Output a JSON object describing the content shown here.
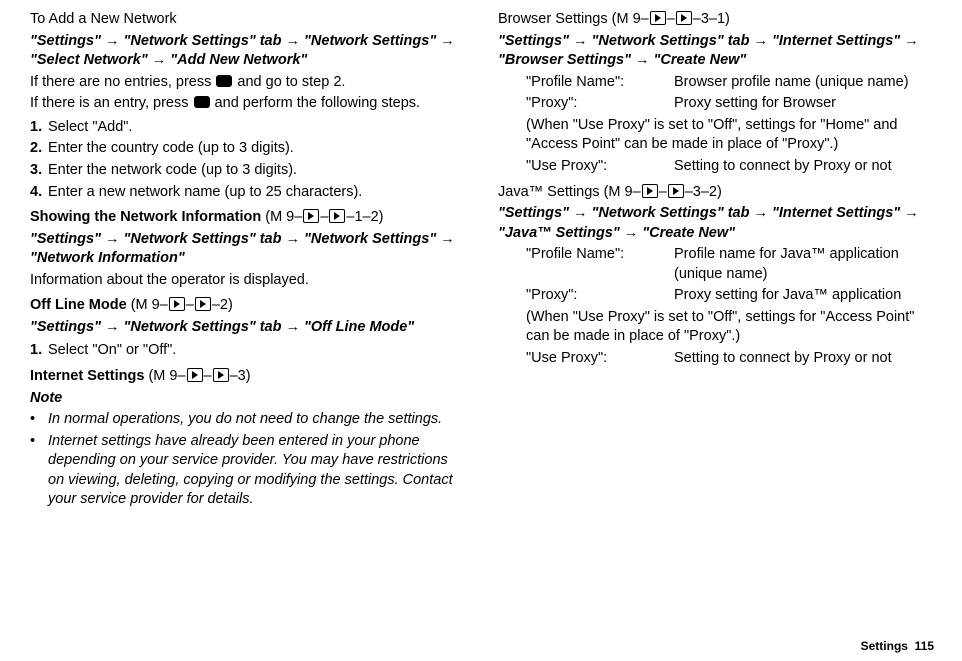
{
  "col1": {
    "addnet_title": "To Add a New Network",
    "addnet_path": "\"Settings\" → \"Network Settings\" tab → \"Network Settings\" → \"Select Network\" → \"Add New Network\"",
    "addnet_noEntries_pre": "If there are no entries, press ",
    "addnet_noEntries_post": " and go to step 2.",
    "addnet_entry_pre": "If there is an entry, press ",
    "addnet_entry_post": " and perform the following steps.",
    "addnet_steps": [
      "Select \"Add\".",
      "Enter the country code (up to 3 digits).",
      "Enter the network code (up to 3 digits).",
      "Enter a new network name (up to 25 characters)."
    ],
    "netinfo_title_pre": "Showing the Network Information ",
    "netinfo_code_pre": "(M 9–",
    "netinfo_code_post": "–1–2)",
    "netinfo_path": "\"Settings\" → \"Network Settings\" tab → \"Network Settings\" → \"Network Information\"",
    "netinfo_desc": "Information about the operator is displayed.",
    "offline_title": "Off Line Mode ",
    "offline_code_pre": "(M 9–",
    "offline_code_post": "–2)",
    "offline_path": "\"Settings\" → \"Network Settings\" tab → \"Off Line Mode\"",
    "offline_step1": "Select \"On\" or \"Off\".",
    "inet_title": "Internet Settings ",
    "inet_code_pre": "(M 9–",
    "inet_code_post": "–3)",
    "note_label": "Note",
    "note_bullets": [
      "In normal operations, you do not need to change the settings.",
      "Internet settings have already been entered in your phone depending on your service provider. You may have restrictions on viewing, deleting, copying or modifying the settings. Contact your service provider for details."
    ]
  },
  "col2": {
    "browser_title": "Browser Settings ",
    "browser_code_pre": "(M 9–",
    "browser_code_post": "–3–1)",
    "browser_path": "\"Settings\" → \"Network Settings\" tab → \"Internet Settings\" → \"Browser Settings\" → \"Create New\"",
    "browser_rows": [
      {
        "k": "\"Profile Name\":",
        "v": "Browser profile name (unique name)"
      },
      {
        "k": "\"Proxy\":",
        "v": "Proxy setting for Browser"
      }
    ],
    "browser_proxy_note": "(When \"Use Proxy\" is set to \"Off\", settings for \"Home\" and \"Access Point\" can be made in place of \"Proxy\".)",
    "browser_useproxy_k": "\"Use Proxy\":",
    "browser_useproxy_v": "Setting to connect by Proxy or not",
    "java_title": "Java™ Settings ",
    "java_code_pre": "(M 9–",
    "java_code_post": "–3–2)",
    "java_path": "\"Settings\" → \"Network Settings\" tab → \"Internet Settings\" → \"Java™ Settings\" → \"Create New\"",
    "java_rows": [
      {
        "k": "\"Profile Name\":",
        "v": "Profile name for Java™ application (unique name)"
      },
      {
        "k": "\"Proxy\":",
        "v": "Proxy setting for Java™ application"
      }
    ],
    "java_proxy_note": "(When \"Use Proxy\" is set to \"Off\", settings for \"Access Point\" can be made in place of \"Proxy\".)",
    "java_useproxy_k": "\"Use Proxy\":",
    "java_useproxy_v": "Setting to connect by Proxy or not"
  },
  "footer": {
    "label": "Settings",
    "page": "115"
  }
}
